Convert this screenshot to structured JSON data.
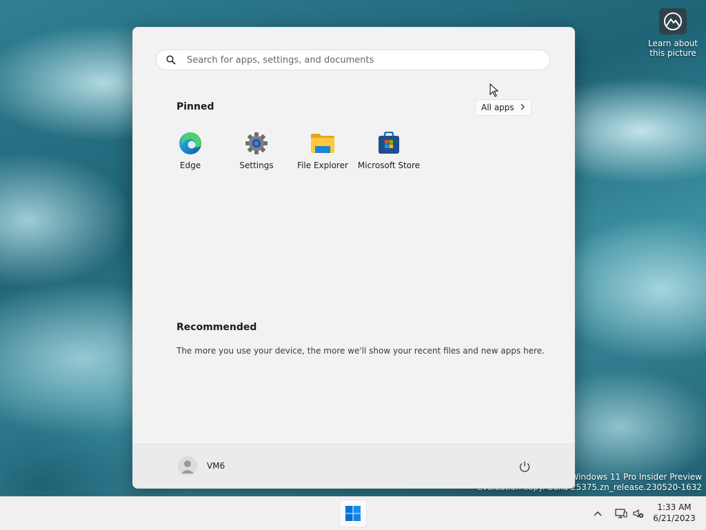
{
  "desktop": {
    "widget_label": "Learn about this picture",
    "watermark_line1": "Windows 11 Pro Insider Preview",
    "watermark_line2": "Evaluation copy. Build 25375.zn_release.230520-1632"
  },
  "start_menu": {
    "search_placeholder": "Search for apps, settings, and documents",
    "pinned_title": "Pinned",
    "all_apps_label": "All apps",
    "pinned_apps": [
      {
        "label": "Edge",
        "icon": "edge-icon"
      },
      {
        "label": "Settings",
        "icon": "settings-gear-icon"
      },
      {
        "label": "File Explorer",
        "icon": "folder-icon"
      },
      {
        "label": "Microsoft Store",
        "icon": "store-bag-icon"
      }
    ],
    "recommended_title": "Recommended",
    "recommended_text": "The more you use your device, the more we'll show your recent files and new apps here.",
    "user_name": "VM6"
  },
  "taskbar": {
    "time": "1:33 AM",
    "date": "6/21/2023"
  },
  "colors": {
    "accent": "#0067c0",
    "menu_bg": "#f2f2f2",
    "taskbar_bg": "#f0f0f0"
  }
}
